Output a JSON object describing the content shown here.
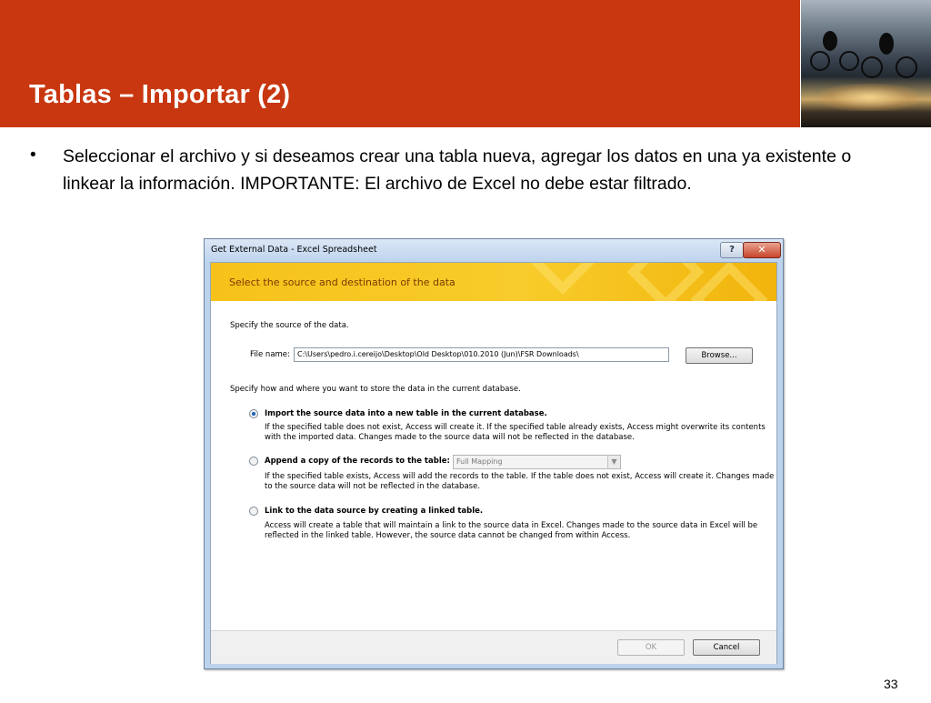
{
  "slide": {
    "title": "Tablas – Importar (2)",
    "bullet_marker": "•",
    "bullet_text": "Seleccionar el archivo y si deseamos crear una tabla nueva, agregar los datos en una ya existente o linkear la información. IMPORTANTE: El archivo de Excel no debe estar filtrado.",
    "page_number": "33"
  },
  "dialog": {
    "title": "Get External Data - Excel Spreadsheet",
    "help_label": "?",
    "close_label": "✕",
    "banner": "Select the source and destination of the data",
    "source_label": "Specify the source of the data.",
    "file_label": "File name:",
    "file_value": "C:\\Users\\pedro.i.cereijo\\Desktop\\Old Desktop\\010.2010 (Jun)\\FSR Downloads\\",
    "browse_label": "Browse...",
    "store_label": "Specify how and where you want to store the data in the current database.",
    "option_import": {
      "label": "Import the source data into a new table in the current database.",
      "desc1": "If the specified table does not exist, Access will create it. If the specified table already exists, Access might overwrite its contents",
      "desc2": "with the imported data. Changes made to the source data will not be reflected in the database.",
      "selected": true
    },
    "option_append": {
      "label": "Append a copy of the records to the table:",
      "combo_value": "Full Mapping",
      "desc1": "If the specified table exists, Access will add the records to the table. If the table does not exist, Access will create it. Changes made",
      "desc2": "to the source data will not be reflected in the database.",
      "selected": false
    },
    "option_link": {
      "label": "Link to the data source by creating a linked table.",
      "desc1": "Access will create a table that will maintain a link to the source data in Excel. Changes made to the source data in Excel will be",
      "desc2": "reflected in the linked table. However, the source data cannot be changed from within Access.",
      "selected": false
    },
    "ok_label": "OK",
    "cancel_label": "Cancel"
  }
}
